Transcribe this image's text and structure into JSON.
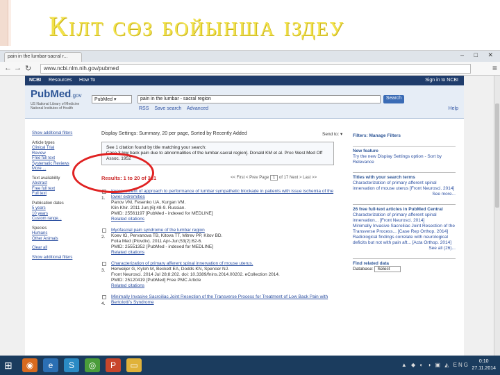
{
  "slide": {
    "title": "Кілт сөз бойынша іздеу"
  },
  "browser": {
    "tab_label": "pain in the lumbar-sacral r...",
    "url": "www.ncbi.nlm.nih.gov/pubmed",
    "window_buttons": "– □ ✕"
  },
  "ncbi": {
    "logo": "NCBI",
    "resources": "Resources",
    "howto": "How To",
    "signin": "Sign in to NCBI"
  },
  "pubmed": {
    "logo_main": "PubMed",
    "logo_gov": ".gov",
    "subtitle": "US National Library of Medicine National Institutes of Health",
    "db_select": "PubMed",
    "query": "pain in the lumbar - sacral region",
    "search_button": "Search",
    "rss": "RSS",
    "save_search": "Save search",
    "advanced": "Advanced",
    "help": "Help"
  },
  "left_filters": {
    "show_filters": "Show additional filters",
    "article_types": [
      "Article types",
      "Clinical Trial",
      "Review",
      "Free full text",
      "Review",
      "Systematic Reviews",
      "More ..."
    ],
    "text_availability": [
      "Text availability",
      "Abstract",
      "Free full text",
      "Full text"
    ],
    "pub_dates": [
      "Publication dates",
      "5 years",
      "10 years",
      "Custom range..."
    ],
    "species": [
      "Species",
      "Humans",
      "Other Animals"
    ],
    "clear_all": "Clear all",
    "show_additional": "Show additional filters"
  },
  "main": {
    "display_settings": "Display Settings: Summary, 20 per page, Sorted by Recently Added",
    "send_to": "Send to:",
    "notice_line1": "See 1 citation found by title matching your search:",
    "notice_line2": "Case 3 low back pain due to abnormalities of the lumbar-sacral region]. Donald KM et al. Proc West Med Off Assoc. 1952",
    "results_count": "Results: 1 to 20 of 331",
    "pager_first": "<< First",
    "pager_prev": "< Prev",
    "pager_page": "Page",
    "pager_page_num": "1",
    "pager_of": "of 17",
    "pager_next": "Next >",
    "pager_last": "Last >>",
    "results": [
      {
        "num": "1.",
        "title": "Improvement of approach to performance of lumbar sympathetic blockade in patients with issue ischemia of the lower extremities",
        "authors": "Panov VM, Fesenko UA, Kurgan VM.",
        "journal": "Klin Khir. 2011 Jun;(6):48-9. Russian.",
        "pmid": "PMID: 25561197 [PubMed - indexed for MEDLINE]",
        "related": "Related citations"
      },
      {
        "num": "2.",
        "title": "Myofascial pain syndrome of the lumbar region",
        "authors": "Koev IG, Pervanova TB, Kitova TT, Mitrev PP, Kitov BD.",
        "journal": "Folia Med (Plovdiv). 2011 Apr-Jun;53(2):62-6.",
        "pmid": "PMID: 25551352 [PubMed - indexed for MEDLINE]",
        "related": "Related citations"
      },
      {
        "num": "3.",
        "title": "Characterization of primary afferent spinal innervation of mouse uterus.",
        "authors": "Herweijer G, Kyloh M, Beckett EA, Dodds KN, Spencer NJ.",
        "journal": "Front Neurosci. 2014 Jul 28;8:202. doi: 10.3389/fnins.2014.00202. eCollection 2014.",
        "pmid": "PMID: 25120419 [PubMed]  Free PMC Article",
        "related": "Related citations"
      },
      {
        "num": "4.",
        "title": "Minimally Invasive Sacroiliac Joint Resection of the Transverse Process for Treatment of Low Back Pain with Bertolotti's Syndrome",
        "authors": "",
        "journal": "",
        "pmid": "",
        "related": ""
      }
    ]
  },
  "right": {
    "filters": "Filters: Manage Filters",
    "new_feature_hd": "New feature",
    "new_feature_txt": "Try the new Display Settings option - Sort by Relevance",
    "titles_hd": "Titles with your search terms",
    "titles_txt": "Characterization of primary afferent spinal innervation of mouse uterus [Front Neurosci. 2014]",
    "titles_more": "See more...",
    "free_hd": "26 free full-text articles in PubMed Central",
    "free_1": "Characterization of primary afferent spinal innervation... [Front Neurosci. 2014]",
    "free_2": "Minimally Invasive Sacroiliac Joint Resection of the Transverse Process... [Case Rep Orthop. 2014]",
    "free_3": "Radiological findings correlate with neurological deficits but not with pain aft... [Acta Orthop. 2014]",
    "free_more": "See all (26)...",
    "related_hd": "Find related data",
    "db_label": "Database:",
    "db_select": "Select"
  },
  "taskbar": {
    "lang": "ENG",
    "time": "0:10",
    "date": "27.11.2014"
  }
}
